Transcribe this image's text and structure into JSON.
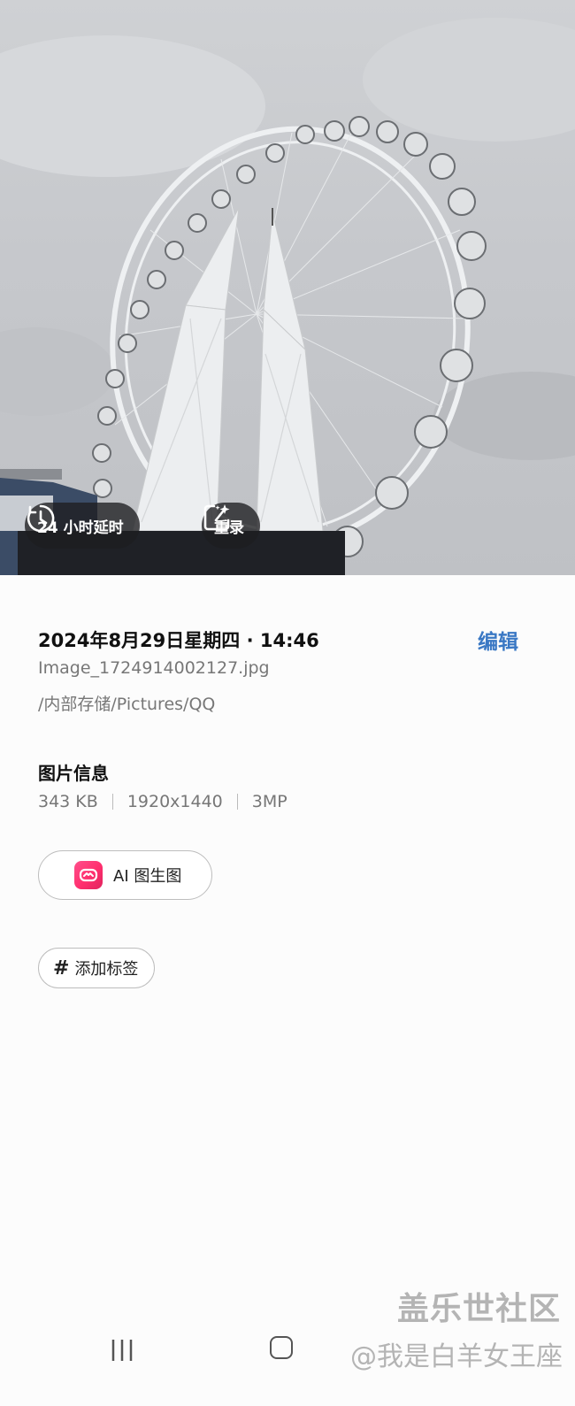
{
  "photo": {
    "subject": "ferris-wheel",
    "sky_color": "#c9cbce"
  },
  "overlay_buttons": {
    "live_label": "24 小时延时",
    "live_icon": "clock-timer-icon",
    "remaster_label": "重录",
    "remaster_icon": "sparkle-frame-icon"
  },
  "details": {
    "datetime": "2024年8月29日星期四 · 14:46",
    "edit_label": "编辑",
    "filename": "Image_1724914002127.jpg",
    "path": "/内部存储/Pictures/QQ"
  },
  "image_info": {
    "title": "图片信息",
    "size": "343 KB",
    "resolution": "1920x1440",
    "megapixels": "3MP"
  },
  "ai_button": {
    "label": "AI 图生图",
    "icon": "ai-app-logo-icon"
  },
  "tag_button": {
    "hash": "#",
    "label": "添加标签"
  },
  "watermark": {
    "line1": "盖乐世社区",
    "line2": "@我是白羊女王座"
  },
  "colors": {
    "accent": "#3a78c4",
    "pill_bg": "#1e1e20"
  }
}
